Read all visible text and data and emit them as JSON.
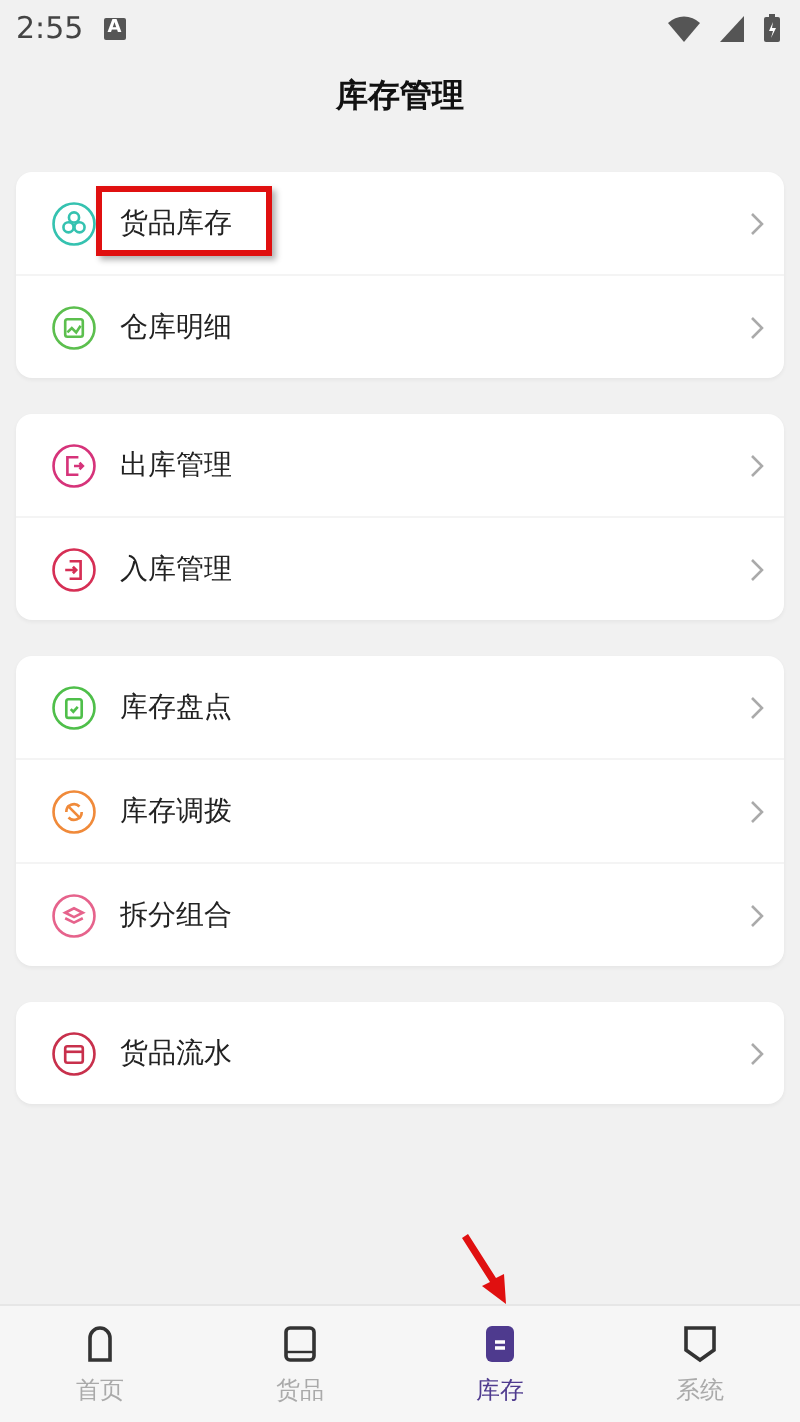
{
  "status_bar": {
    "time": "2:55",
    "notice": "A"
  },
  "header": {
    "title": "库存管理"
  },
  "groups": [
    {
      "items": [
        {
          "label": "货品库存",
          "color": "#35c2b0",
          "highlighted": true
        },
        {
          "label": "仓库明细",
          "color": "#5cbf4e",
          "highlighted": false
        }
      ]
    },
    {
      "items": [
        {
          "label": "出库管理",
          "color": "#d6337a",
          "highlighted": false
        },
        {
          "label": "入库管理",
          "color": "#d62f55",
          "highlighted": false
        }
      ]
    },
    {
      "items": [
        {
          "label": "库存盘点",
          "color": "#4fbf4a",
          "highlighted": false
        },
        {
          "label": "库存调拨",
          "color": "#f08a3a",
          "highlighted": false
        },
        {
          "label": "拆分组合",
          "color": "#e6638c",
          "highlighted": false
        }
      ]
    },
    {
      "items": [
        {
          "label": "货品流水",
          "color": "#c8304c",
          "highlighted": false
        }
      ]
    }
  ],
  "tabs": [
    {
      "label": "首页",
      "selected": false,
      "pointed": false
    },
    {
      "label": "货品",
      "selected": false,
      "pointed": false
    },
    {
      "label": "库存",
      "selected": true,
      "pointed": true
    },
    {
      "label": "系统",
      "selected": false,
      "pointed": false
    }
  ]
}
